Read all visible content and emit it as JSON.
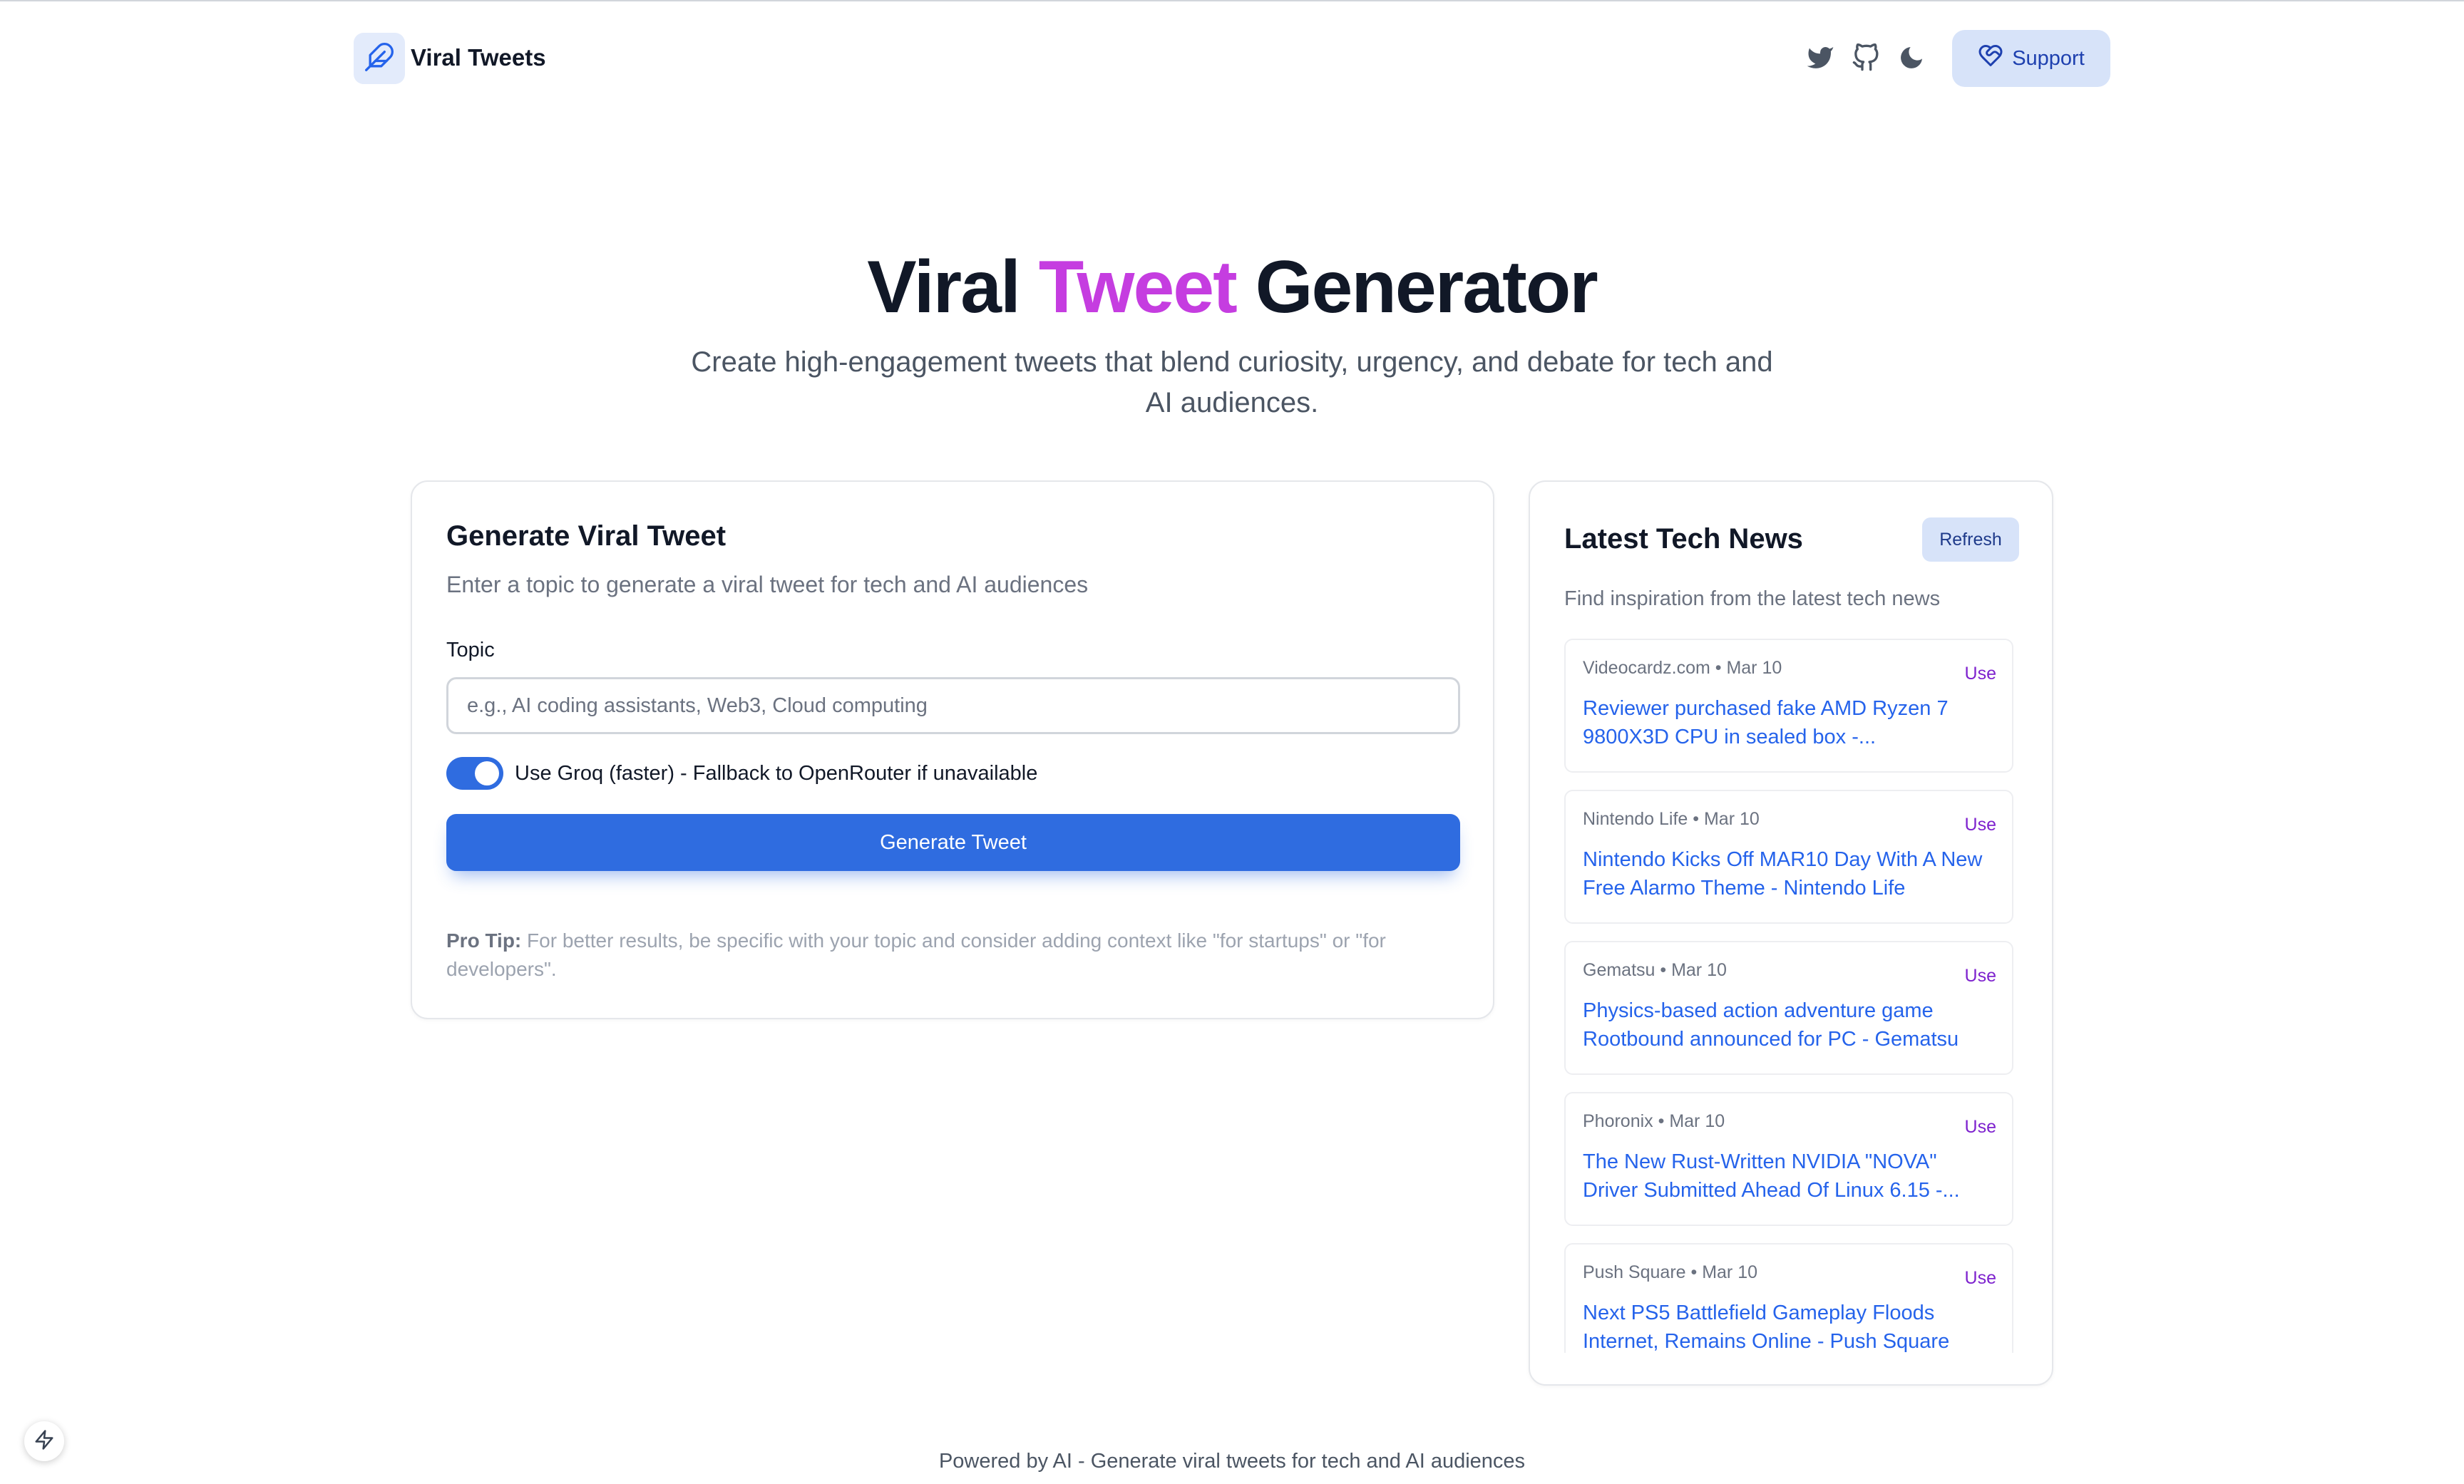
{
  "header": {
    "brand": "Viral Tweets",
    "icons": [
      "feather-icon",
      "twitter-icon",
      "github-icon",
      "moon-icon",
      "heart-handshake-icon"
    ],
    "support_label": "Support"
  },
  "hero": {
    "title_part1": "Viral ",
    "title_accent": "Tweet",
    "title_part2": " Generator",
    "subtitle": "Create high-engagement tweets that blend curiosity, urgency, and debate for tech and AI audiences.",
    "accent_color": "#c53de0"
  },
  "generator": {
    "title": "Generate Viral Tweet",
    "description": "Enter a topic to generate a viral tweet for tech and AI audiences",
    "topic_label": "Topic",
    "topic_value": "",
    "topic_placeholder": "e.g., AI coding assistants, Web3, Cloud computing",
    "toggle_on": true,
    "toggle_label": "Use Groq (faster) - Fallback to OpenRouter if unavailable",
    "button_label": "Generate Tweet",
    "protip_label": "Pro Tip:",
    "protip_text": " For better results, be specific with your topic and consider adding context like \"for startups\" or \"for developers\".",
    "primary_color": "#2f6ce0"
  },
  "news": {
    "title": "Latest Tech News",
    "refresh_label": "Refresh",
    "description": "Find inspiration from the latest tech news",
    "use_label": "Use",
    "items": [
      {
        "meta": "Videocardz.com • Mar 10",
        "headline": "Reviewer purchased fake AMD Ryzen 7 9800X3D CPU in sealed box -..."
      },
      {
        "meta": "Nintendo Life • Mar 10",
        "headline": "Nintendo Kicks Off MAR10 Day With A New Free Alarmo Theme - Nintendo Life"
      },
      {
        "meta": "Gematsu • Mar 10",
        "headline": "Physics-based action adventure game Rootbound announced for PC - Gematsu"
      },
      {
        "meta": "Phoronix • Mar 10",
        "headline": "The New Rust-Written NVIDIA \"NOVA\" Driver Submitted Ahead Of Linux 6.15 -..."
      },
      {
        "meta": "Push Square • Mar 10",
        "headline": "Next PS5 Battlefield Gameplay Floods Internet, Remains Online - Push Square"
      }
    ]
  },
  "footer": {
    "text": "Powered by AI - Generate viral tweets for tech and AI audiences"
  }
}
